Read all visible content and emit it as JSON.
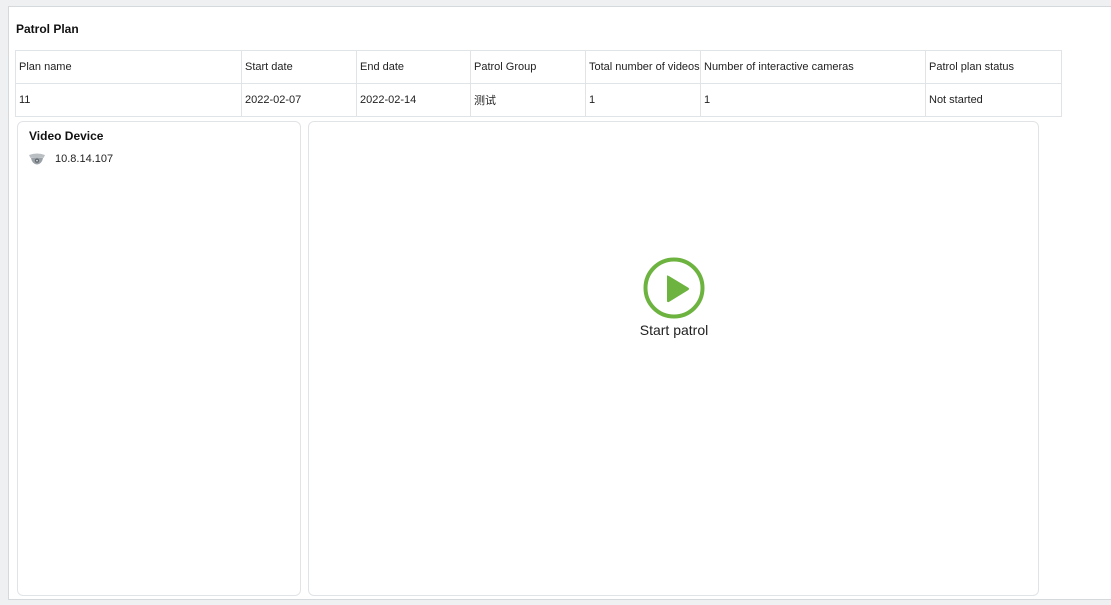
{
  "page": {
    "title": "Patrol Plan"
  },
  "plan_table": {
    "columns": [
      "Plan name",
      "Start date",
      "End date",
      "Patrol Group",
      "Total number of videos",
      "Number of interactive cameras",
      "Patrol plan status"
    ],
    "rows": [
      [
        "11",
        "2022-02-07",
        "2022-02-14",
        "测试",
        "1",
        "1",
        "Not started"
      ]
    ]
  },
  "device_panel": {
    "heading": "Video Device",
    "devices": [
      {
        "label": "10.8.14.107",
        "icon": "camera-icon"
      }
    ]
  },
  "player": {
    "button_label": "Start patrol",
    "icon": "play-circle-icon",
    "accent_color": "#6db33f"
  }
}
